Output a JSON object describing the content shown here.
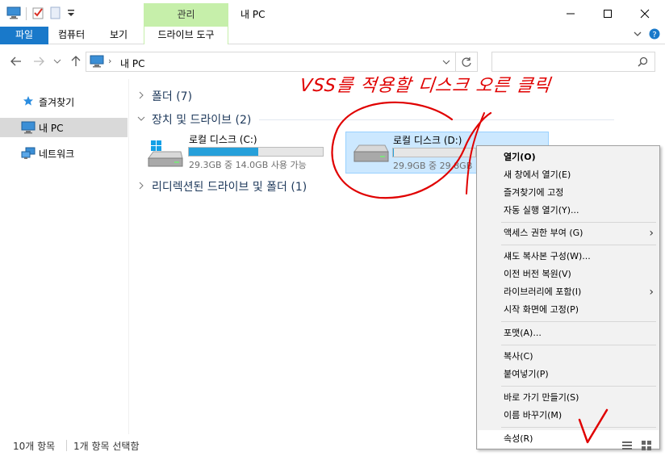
{
  "window": {
    "title": "내 PC",
    "manage_tab": "관리"
  },
  "ribbon": {
    "tabs": [
      "파일",
      "컴퓨터",
      "보기",
      "드라이브 도구"
    ]
  },
  "address": {
    "path_root": "내 PC",
    "search_placeholder": ""
  },
  "nav": {
    "items": [
      {
        "label": "즐겨찾기",
        "icon": "star-icon"
      },
      {
        "label": "내 PC",
        "icon": "computer-icon",
        "selected": true
      },
      {
        "label": "네트워크",
        "icon": "network-icon"
      }
    ]
  },
  "content": {
    "groups": [
      {
        "label": "폴더 (7)",
        "expanded": false
      },
      {
        "label": "장치 및 드라이브 (2)",
        "expanded": true
      },
      {
        "label": "리디렉션된 드라이브 및 폴더 (1)",
        "expanded": false
      }
    ],
    "drives": [
      {
        "name": "로컬 디스크 (C:)",
        "info": "29.3GB 중 14.0GB 사용 가능",
        "used_fraction": 0.52,
        "icon": "windows-drive-icon"
      },
      {
        "name": "로컬 디스크 (D:)",
        "info": "29.9GB 중 29.8GB",
        "used_fraction": 0.01,
        "icon": "hard-drive-icon",
        "selected": true
      }
    ]
  },
  "context_menu": {
    "items": [
      {
        "label": "열기(O)",
        "bold": true
      },
      {
        "label": "새 창에서 열기(E)"
      },
      {
        "label": "즐겨찾기에 고정"
      },
      {
        "label": "자동 실행 열기(Y)..."
      },
      {
        "label": "액세스 권한 부여 (G)",
        "submenu": true
      },
      {
        "label": "섀도 복사본 구성(W)..."
      },
      {
        "label": "이전 버전 복원(V)"
      },
      {
        "label": "라이브러리에 포함(I)",
        "submenu": true
      },
      {
        "label": "시작 화면에 고정(P)"
      },
      {
        "label": "포맷(A)..."
      },
      {
        "label": "복사(C)"
      },
      {
        "label": "붙여넣기(P)"
      },
      {
        "label": "바로 가기 만들기(S)"
      },
      {
        "label": "이름 바꾸기(M)"
      },
      {
        "label": "속성(R)",
        "highlighted": true
      }
    ]
  },
  "status": {
    "item_count": "10개 항목",
    "selection": "1개 항목 선택함"
  },
  "annotation": {
    "text": "VSS를 적용할 디스크 오른 클릭",
    "color": "#e00000"
  },
  "colors": {
    "file_tab": "#1979ca",
    "manage_tab": "#c6efaa",
    "selection": "#cce8ff",
    "progress": "#26a0da"
  }
}
